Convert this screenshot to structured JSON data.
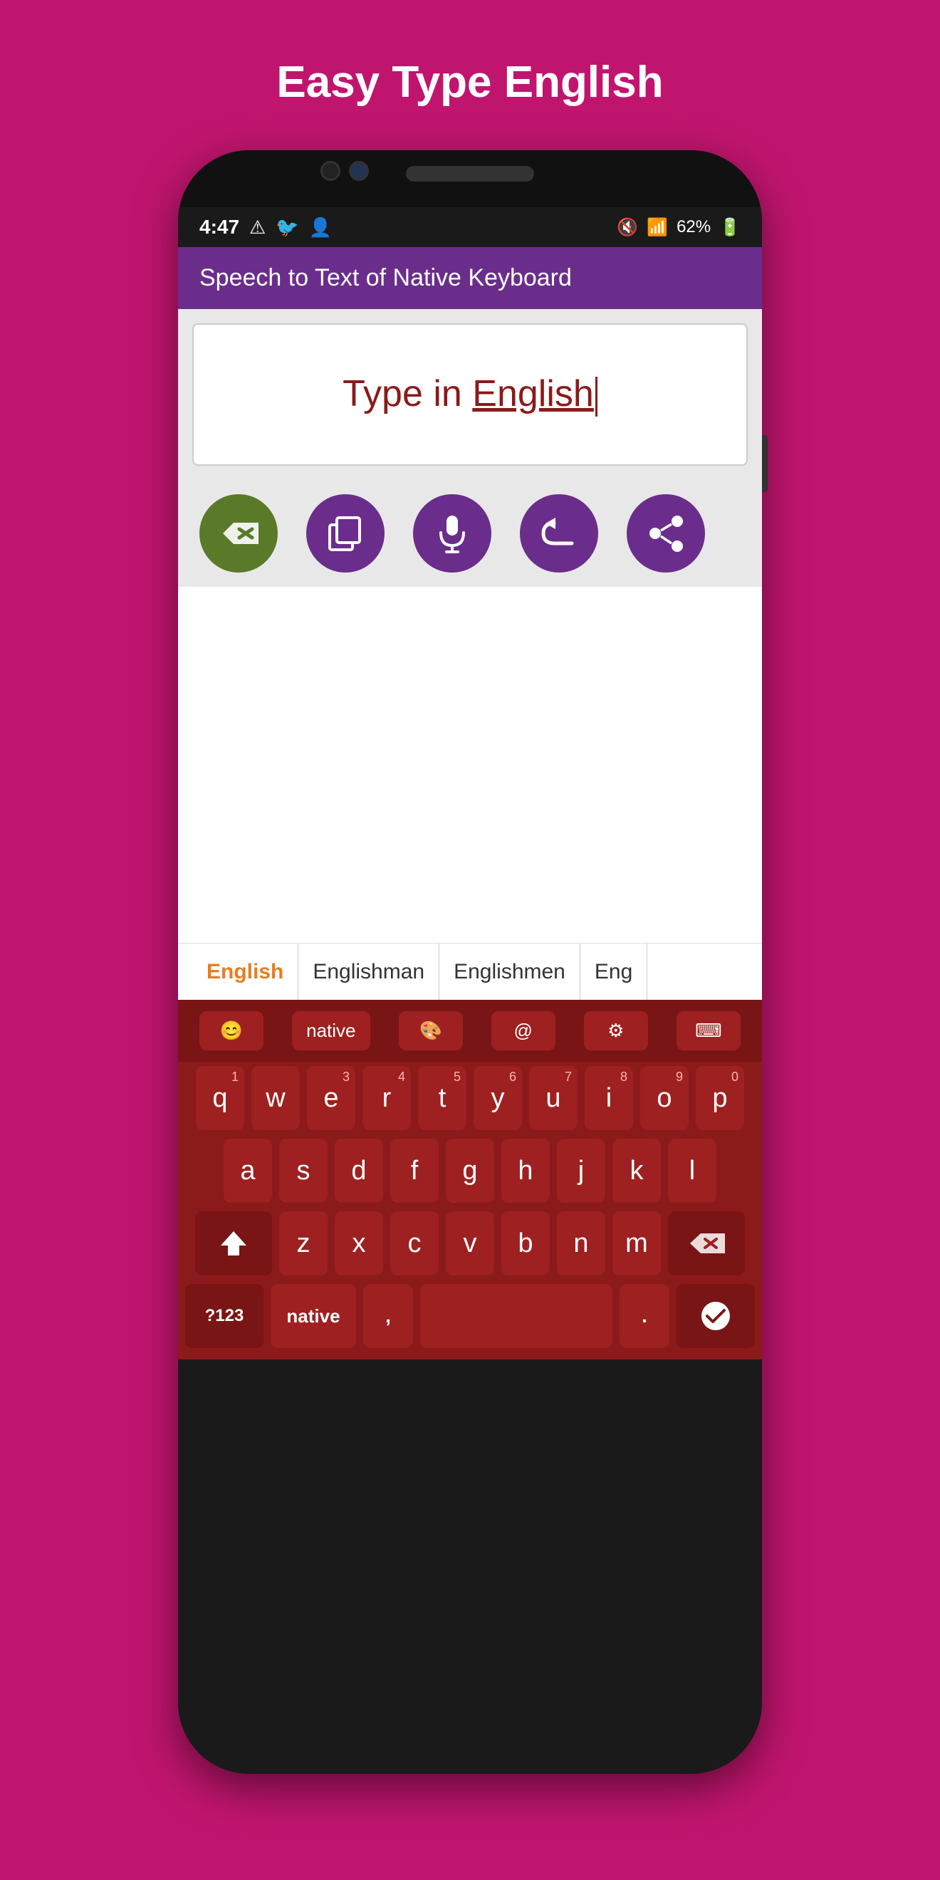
{
  "page": {
    "title": "Easy Type English",
    "background_color": "#c0156e"
  },
  "status_bar": {
    "time": "4:47",
    "battery": "62%",
    "icons": [
      "alert-icon",
      "twitter-icon",
      "person-icon",
      "mute-icon",
      "signal-icon",
      "battery-icon"
    ]
  },
  "app_header": {
    "title": "Speech to Text of Native Keyboard"
  },
  "text_area": {
    "content_prefix": "Type in ",
    "content_highlighted": "English",
    "placeholder": "Type in English"
  },
  "action_buttons": [
    {
      "id": "backspace",
      "label": "backspace-icon",
      "color": "#5a7a2a"
    },
    {
      "id": "copy",
      "label": "copy-icon",
      "color": "#6b2d8b"
    },
    {
      "id": "mic",
      "label": "mic-icon",
      "color": "#6b2d8b"
    },
    {
      "id": "undo",
      "label": "undo-icon",
      "color": "#6b2d8b"
    },
    {
      "id": "share",
      "label": "share-icon",
      "color": "#6b2d8b"
    }
  ],
  "suggestions": [
    {
      "text": "English",
      "active": true
    },
    {
      "text": "Englishman",
      "active": false
    },
    {
      "text": "Englishmen",
      "active": false
    },
    {
      "text": "Eng",
      "active": false
    }
  ],
  "keyboard": {
    "toolbar": [
      {
        "label": "😊",
        "id": "emoji"
      },
      {
        "label": "native",
        "id": "native"
      },
      {
        "label": "🎨",
        "id": "theme"
      },
      {
        "label": "@",
        "id": "at"
      },
      {
        "label": "⚙",
        "id": "settings"
      },
      {
        "label": "⌨",
        "id": "keyboard-switch"
      }
    ],
    "row1": [
      {
        "letter": "q",
        "number": "1"
      },
      {
        "letter": "w",
        "number": ""
      },
      {
        "letter": "e",
        "number": "3"
      },
      {
        "letter": "r",
        "number": "4"
      },
      {
        "letter": "t",
        "number": "5"
      },
      {
        "letter": "y",
        "number": "6"
      },
      {
        "letter": "u",
        "number": "7"
      },
      {
        "letter": "i",
        "number": "8"
      },
      {
        "letter": "o",
        "number": "9"
      },
      {
        "letter": "p",
        "number": "0"
      }
    ],
    "row2": [
      {
        "letter": "a"
      },
      {
        "letter": "s"
      },
      {
        "letter": "d"
      },
      {
        "letter": "f"
      },
      {
        "letter": "g"
      },
      {
        "letter": "h"
      },
      {
        "letter": "j"
      },
      {
        "letter": "k"
      },
      {
        "letter": "l"
      }
    ],
    "row3": [
      {
        "letter": "⇧",
        "wide": true
      },
      {
        "letter": "z"
      },
      {
        "letter": "x"
      },
      {
        "letter": "c"
      },
      {
        "letter": "v"
      },
      {
        "letter": "b"
      },
      {
        "letter": "n"
      },
      {
        "letter": "m"
      },
      {
        "letter": "⌫",
        "wide": true
      }
    ],
    "row4": [
      {
        "label": "?123",
        "id": "numbers"
      },
      {
        "label": "native",
        "id": "native-lang"
      },
      {
        "label": ",",
        "id": "comma"
      },
      {
        "label": "space",
        "id": "space"
      },
      {
        "label": ".",
        "id": "period"
      },
      {
        "label": "✓",
        "id": "done"
      }
    ]
  }
}
